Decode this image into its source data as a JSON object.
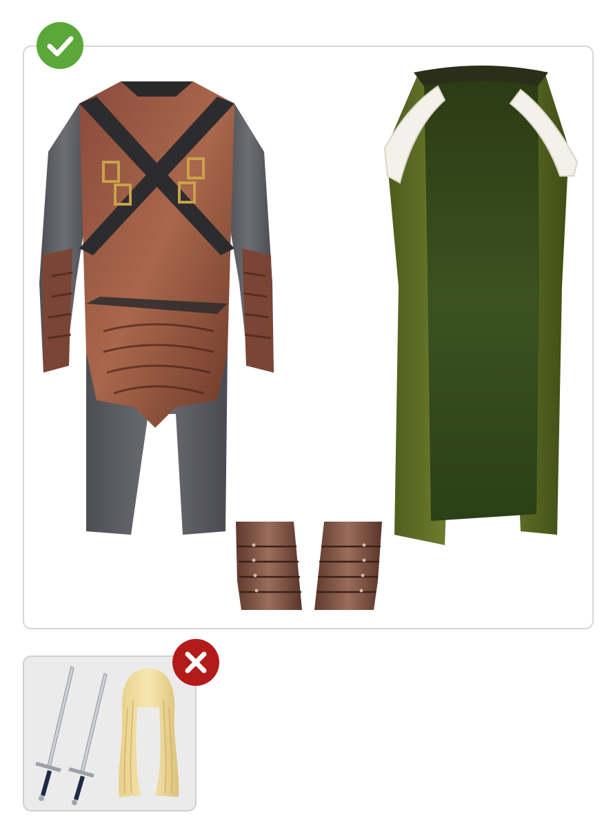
{
  "included": {
    "badge_icon": "check-icon",
    "badge_color": "#5aa83a",
    "items": [
      {
        "name": "armor-print-tunic"
      },
      {
        "name": "green-velvet-cape-with-fur-trim"
      },
      {
        "name": "leather-bracers"
      }
    ]
  },
  "excluded": {
    "badge_icon": "close-icon",
    "badge_color": "#b31b1b",
    "items": [
      {
        "name": "swords"
      },
      {
        "name": "blonde-wig"
      }
    ]
  }
}
